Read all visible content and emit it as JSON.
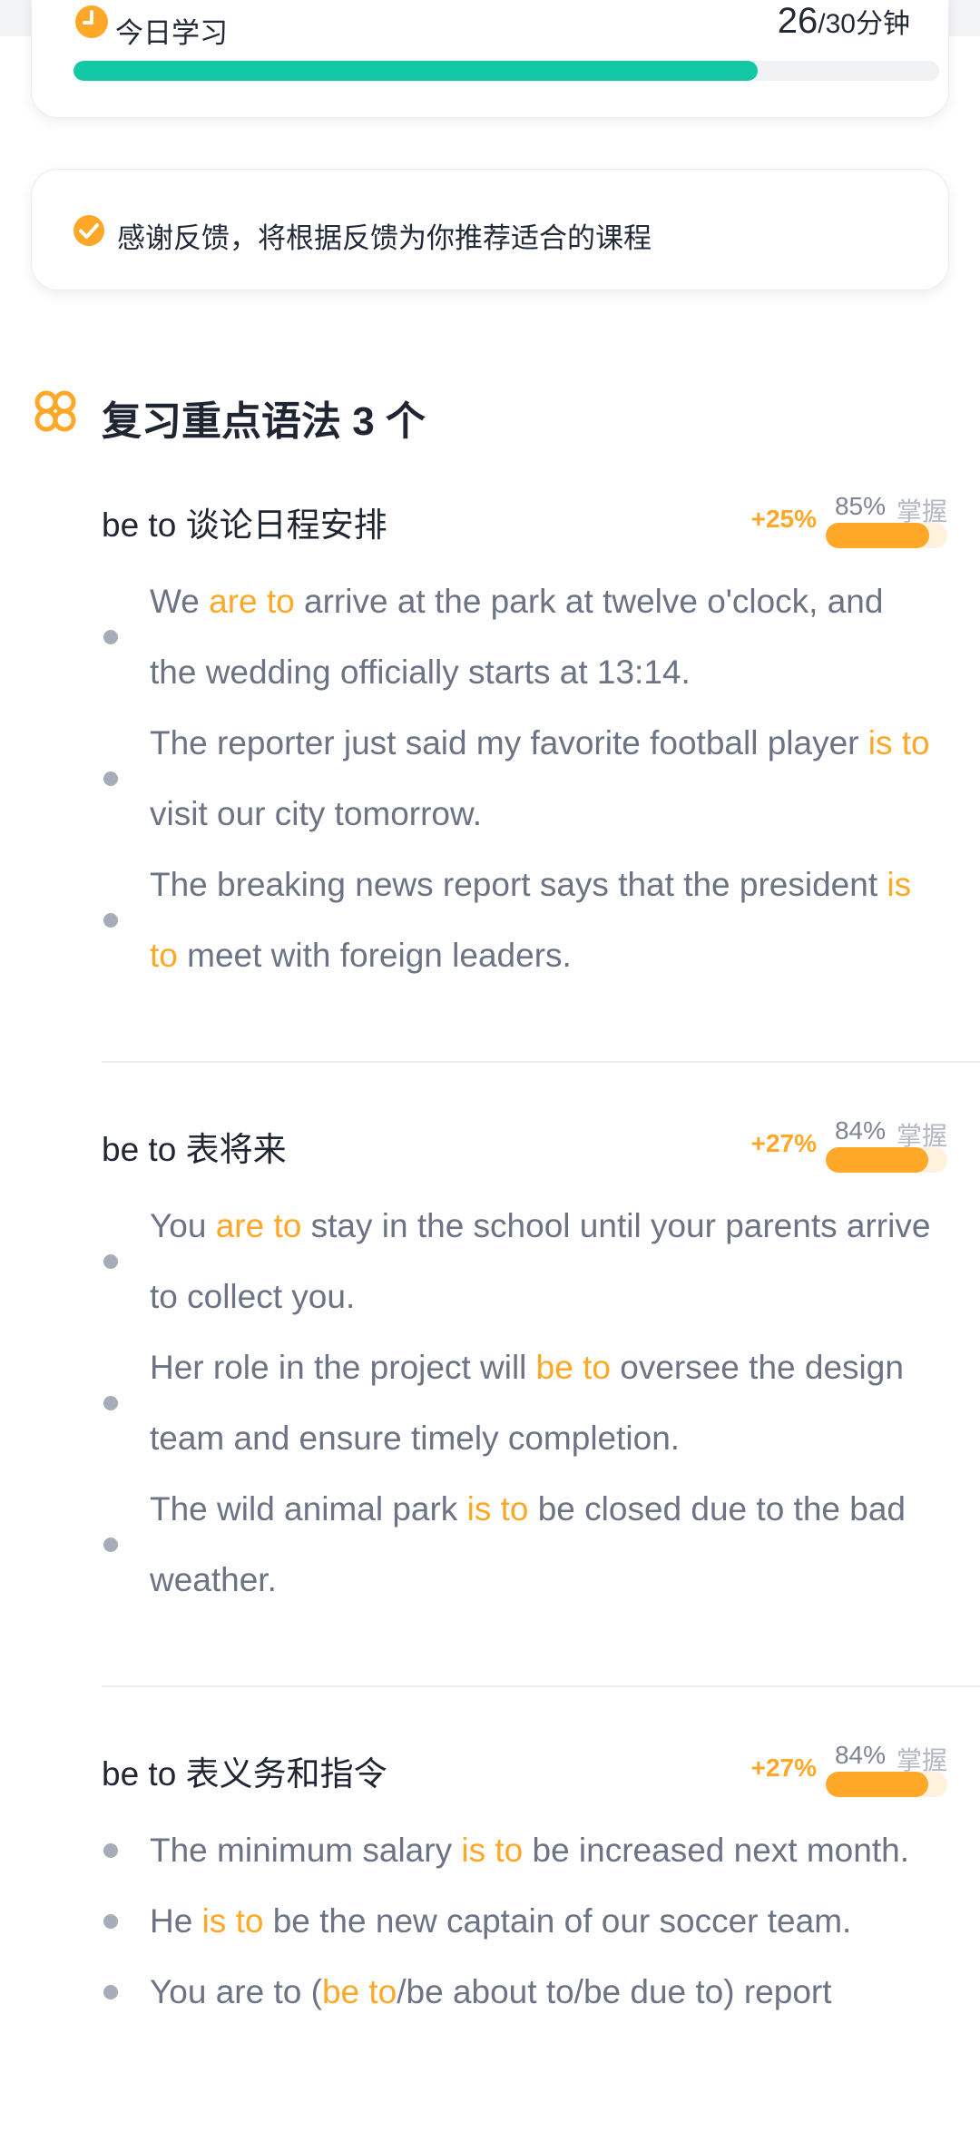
{
  "study": {
    "label": "今日学习",
    "current": "26",
    "total_suffix": "/30分钟",
    "progress": 0.79
  },
  "feedback": {
    "text": "感谢反馈，将根据反馈为你推荐适合的课程"
  },
  "section": {
    "title": "复习重点语法 3 个"
  },
  "grammars": [
    {
      "title": "be to 谈论日程安排",
      "delta": "+25%",
      "percent": "85%",
      "mastery_label": "掌握",
      "mastery": 0.85,
      "sentences": [
        [
          {
            "t": "We ",
            "hl": false
          },
          {
            "t": "are to",
            "hl": true
          },
          {
            "t": " arrive at the park at twelve o'clock, and the wedding officially starts at 13:14.",
            "hl": false
          }
        ],
        [
          {
            "t": "The reporter just said my favorite football player ",
            "hl": false
          },
          {
            "t": "is to",
            "hl": true
          },
          {
            "t": " visit our city tomorrow.",
            "hl": false
          }
        ],
        [
          {
            "t": "The breaking news report says that the president ",
            "hl": false
          },
          {
            "t": "is to",
            "hl": true
          },
          {
            "t": " meet with foreign leaders.",
            "hl": false
          }
        ]
      ]
    },
    {
      "title": "be to 表将来",
      "delta": "+27%",
      "percent": "84%",
      "mastery_label": "掌握",
      "mastery": 0.84,
      "sentences": [
        [
          {
            "t": "You ",
            "hl": false
          },
          {
            "t": "are to",
            "hl": true
          },
          {
            "t": " stay in the school until your parents arrive to collect you.",
            "hl": false
          }
        ],
        [
          {
            "t": "Her role in the project will ",
            "hl": false
          },
          {
            "t": "be to",
            "hl": true
          },
          {
            "t": " oversee the design team and ensure timely completion.",
            "hl": false
          }
        ],
        [
          {
            "t": "The wild animal park ",
            "hl": false
          },
          {
            "t": "is to",
            "hl": true
          },
          {
            "t": " be closed due to the bad weather.",
            "hl": false
          }
        ]
      ]
    },
    {
      "title": "be to 表义务和指令",
      "delta": "+27%",
      "percent": "84%",
      "mastery_label": "掌握",
      "mastery": 0.84,
      "sentences": [
        [
          {
            "t": "The minimum salary ",
            "hl": false
          },
          {
            "t": "is to",
            "hl": true
          },
          {
            "t": " be increased next month.",
            "hl": false
          }
        ],
        [
          {
            "t": "He ",
            "hl": false
          },
          {
            "t": "is to",
            "hl": true
          },
          {
            "t": " be the new captain of our soccer team.",
            "hl": false
          }
        ],
        [
          {
            "t": "You are to (",
            "hl": false
          },
          {
            "t": "be to",
            "hl": true
          },
          {
            "t": "/be about to/be due to) report",
            "hl": false
          }
        ]
      ]
    }
  ],
  "colors": {
    "accent_orange": "#ffa827",
    "progress_green": "#13c8a4",
    "text_dark": "#1f2533",
    "text_gray": "#6b7384"
  }
}
